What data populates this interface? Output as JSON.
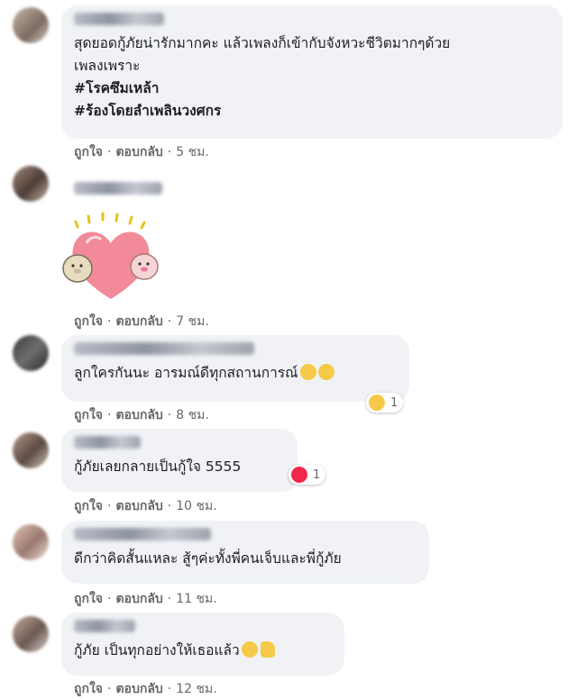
{
  "comments": [
    {
      "lines": [
        "สุดยอดกู้ภัยน่ารักมากคะ แล้วเพลงก็เข้ากับจังหวะชีวิตมากๆด้วย",
        "เพลงเพราะ"
      ],
      "hashtags": [
        "#โรคซึมเหล้า",
        "#ร้องโดยลำเพลินวงศกร"
      ],
      "like": "ถูกใจ",
      "reply": "ตอบกลับ",
      "time": "5 ชม."
    },
    {
      "sticker": "heart-bears-sticker",
      "like": "ถูกใจ",
      "reply": "ตอบกลับ",
      "time": "7 ชม."
    },
    {
      "lines": [
        "ลูกใครกันนะ อารมณ์ดีทุกสถานการณ์"
      ],
      "reaction_count": "1",
      "like": "ถูกใจ",
      "reply": "ตอบกลับ",
      "time": "8 ชม."
    },
    {
      "lines": [
        "กู้ภัยเลยกลายเป็นกู้ใจ 5555"
      ],
      "reaction_count": "1",
      "like": "ถูกใจ",
      "reply": "ตอบกลับ",
      "time": "10 ชม."
    },
    {
      "lines": [
        "ดีกว่าคิดสั้นแหละ สู้ๆค่ะทั้งพี่คนเจ็บและพี่กู้ภัย"
      ],
      "like": "ถูกใจ",
      "reply": "ตอบกลับ",
      "time": "11 ชม."
    },
    {
      "lines": [
        "กู้ภัย เป็นทุกอย่างให้เธอแล้ว"
      ],
      "like": "ถูกใจ",
      "reply": "ตอบกลับ",
      "time": "12 ชม."
    }
  ],
  "separator": "·",
  "colors": {
    "bubble": "#f0f2f5",
    "meta": "#65676b",
    "heart": "#f0284a"
  }
}
